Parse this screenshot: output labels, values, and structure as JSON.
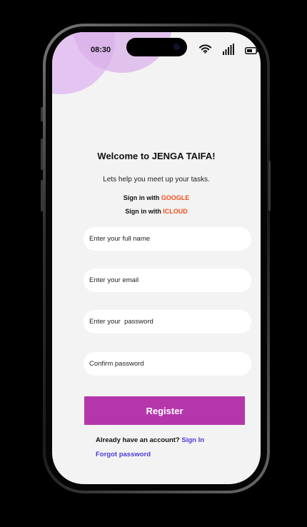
{
  "status_bar": {
    "time": "08:30",
    "icons": [
      "wifi-icon",
      "signal-icon",
      "battery-icon"
    ]
  },
  "header": {
    "title": "Welcome to JENGA TAIFA!",
    "subtitle": "Lets help you  meet up your tasks."
  },
  "social_signin": [
    {
      "prefix": "Sign in with ",
      "provider": "GOOGLE"
    },
    {
      "prefix": "Sign in with  ",
      "provider": "ICLOUD"
    }
  ],
  "form": {
    "full_name_placeholder": "Enter your full name",
    "email_placeholder": "Enter your email",
    "password_placeholder": "Enter your  password",
    "confirm_placeholder": "Confirm password",
    "register_label": "Register"
  },
  "footer": {
    "already_text": "Already have an account? ",
    "signin_link": "Sign In",
    "forgot_link": "Forgot password"
  },
  "colors": {
    "accent": "#f04e1a",
    "button": "#b536ab",
    "link": "#4b3cd6",
    "blob": "#d9b2ea"
  }
}
